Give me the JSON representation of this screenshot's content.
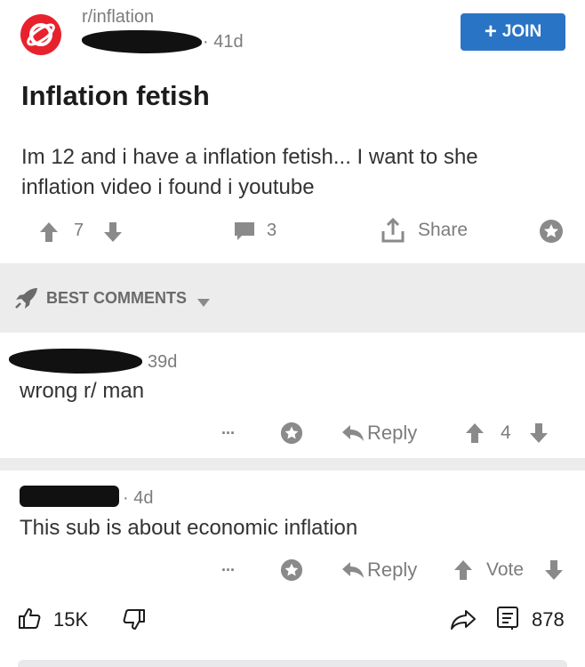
{
  "post": {
    "subreddit": "r/inflation",
    "age": "41d",
    "join_label": "JOIN",
    "title": "Inflation fetish",
    "body": "Im 12 and i have a inflation fetish... I want to she inflation video i found i youtube",
    "upvotes": "7",
    "comments": "3",
    "share_label": "Share"
  },
  "sort": {
    "label": "BEST COMMENTS"
  },
  "comments": [
    {
      "age": "39d",
      "text": "wrong r/ man",
      "more": "...",
      "reply_label": "Reply",
      "score": "4"
    },
    {
      "age": "4d",
      "text": "This sub is about economic inflation",
      "more": "...",
      "reply_label": "Reply",
      "score": "Vote"
    }
  ],
  "footer": {
    "likes": "15K",
    "comment_count": "878"
  },
  "colors": {
    "join_bg": "#2a74c6",
    "subreddit_icon": "#e8222d",
    "band": "#ececec"
  }
}
